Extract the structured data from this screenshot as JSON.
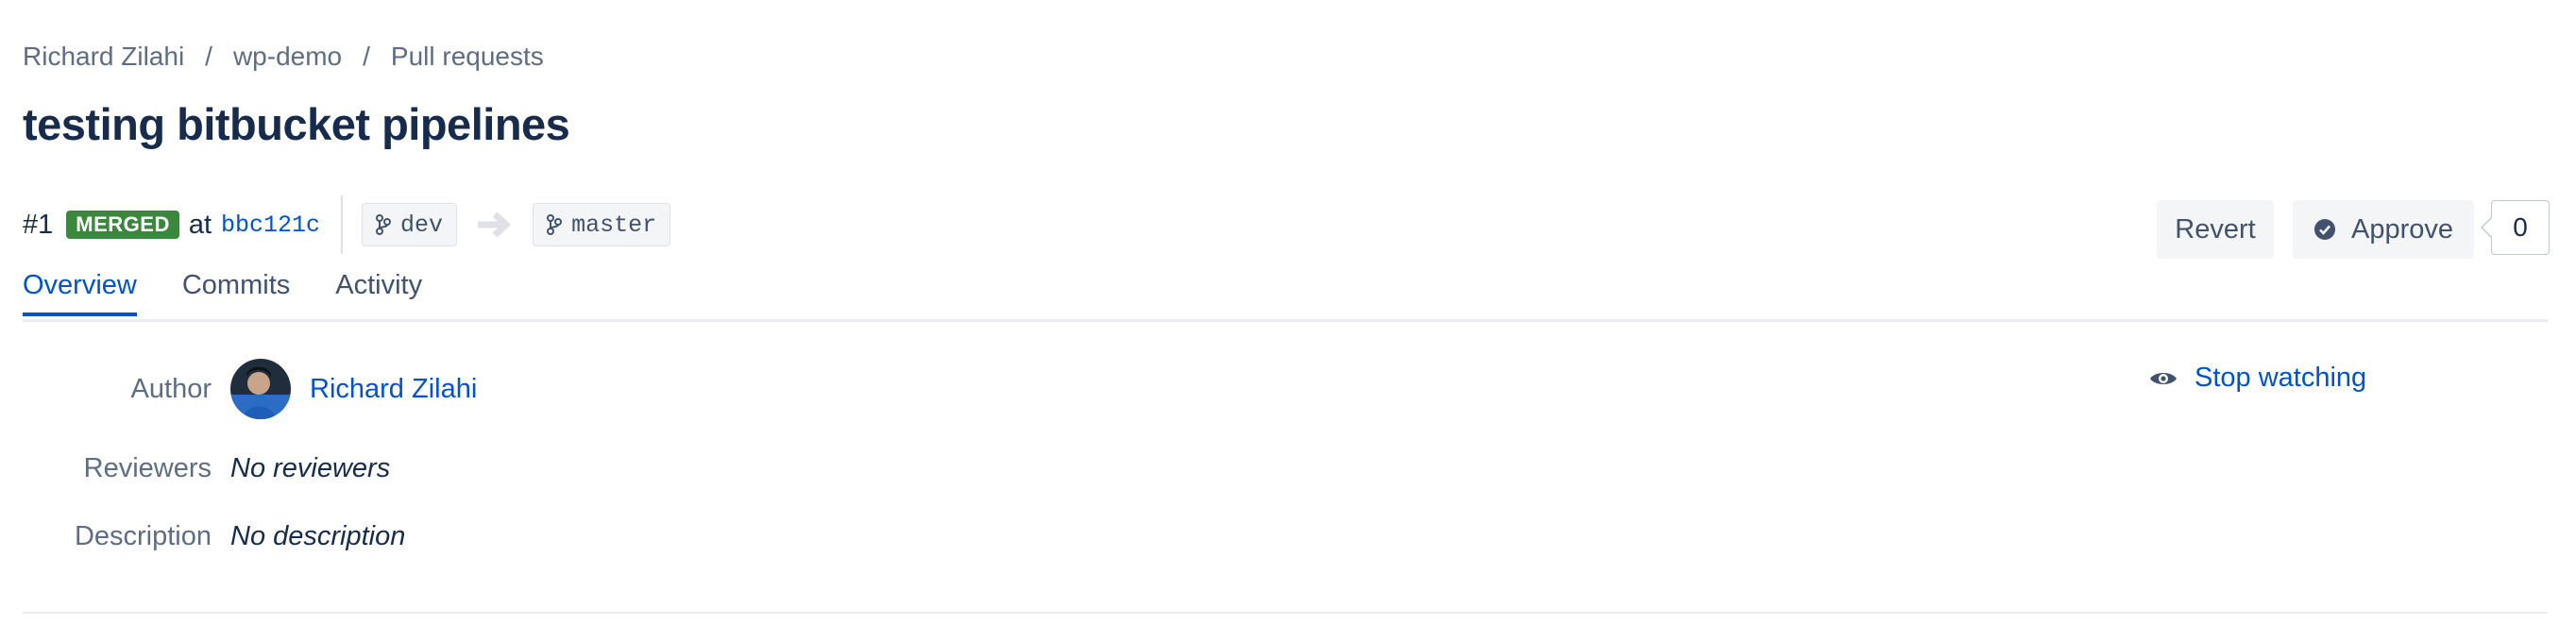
{
  "breadcrumb": {
    "items": [
      "Richard Zilahi",
      "wp-demo",
      "Pull requests"
    ],
    "separator": "/"
  },
  "pr": {
    "title": "testing bitbucket pipelines",
    "number": "#1",
    "status": "MERGED",
    "at_label": "at",
    "commit": "bbc121c",
    "source_branch": "dev",
    "target_branch": "master"
  },
  "actions": {
    "revert_label": "Revert",
    "approve_label": "Approve",
    "approve_count": "0"
  },
  "tabs": [
    {
      "label": "Overview",
      "active": true
    },
    {
      "label": "Commits",
      "active": false
    },
    {
      "label": "Activity",
      "active": false
    }
  ],
  "details": {
    "author_label": "Author",
    "author_name": "Richard Zilahi",
    "reviewers_label": "Reviewers",
    "reviewers_value": "No reviewers",
    "description_label": "Description",
    "description_value": "No description"
  },
  "watch": {
    "label": "Stop watching",
    "icon": "eye-icon"
  },
  "colors": {
    "accent": "#0052cc",
    "merged": "#3b873e",
    "text": "#172b4d",
    "muted": "#5e6c84"
  }
}
